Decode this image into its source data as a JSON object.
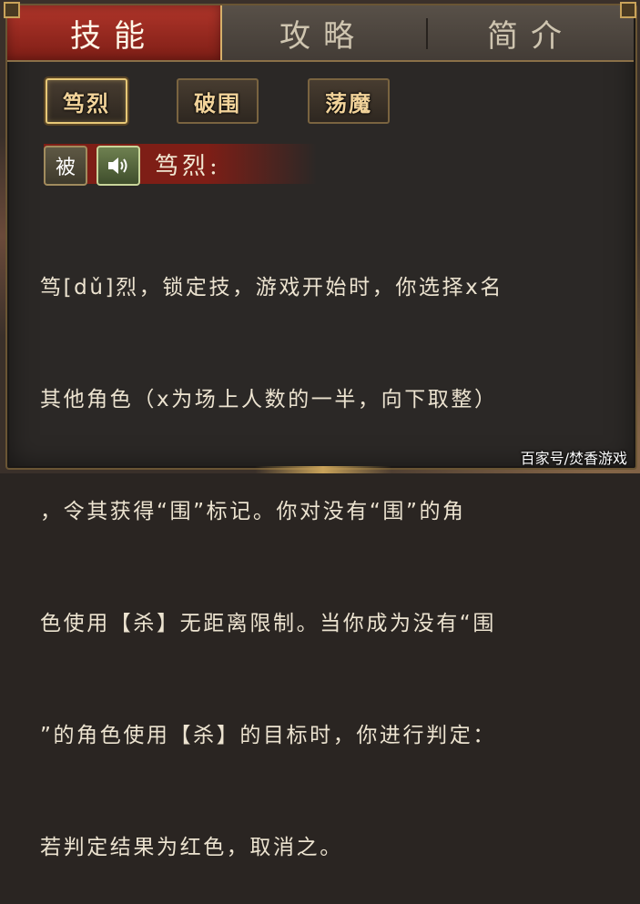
{
  "tabs": [
    {
      "label": "技能",
      "active": true
    },
    {
      "label": "攻略",
      "active": false
    },
    {
      "label": "简介",
      "active": false
    }
  ],
  "skills": [
    {
      "label": "笃烈",
      "active": true
    },
    {
      "label": "破围",
      "active": false
    },
    {
      "label": "荡魔",
      "active": false
    }
  ],
  "skill_detail": {
    "type_badge": "被",
    "sound_icon": "speaker-icon",
    "name": "笃烈:",
    "description_lines": [
      "笃[dǔ]烈，锁定技，游戏开始时，你选择x名",
      "其他角色（x为场上人数的一半，向下取整）",
      "，令其获得“围”标记。你对没有“围”的角",
      "色使用【杀】无距离限制。当你成为没有“围",
      "”的角色使用【杀】的目标时，你进行判定：",
      "若判定结果为红色，取消之。"
    ]
  },
  "watermark": "百家号/焚香游戏",
  "colors": {
    "active_tab": "#9a2a20",
    "gold_border": "#c9a35a",
    "text": "#ece3d0"
  }
}
